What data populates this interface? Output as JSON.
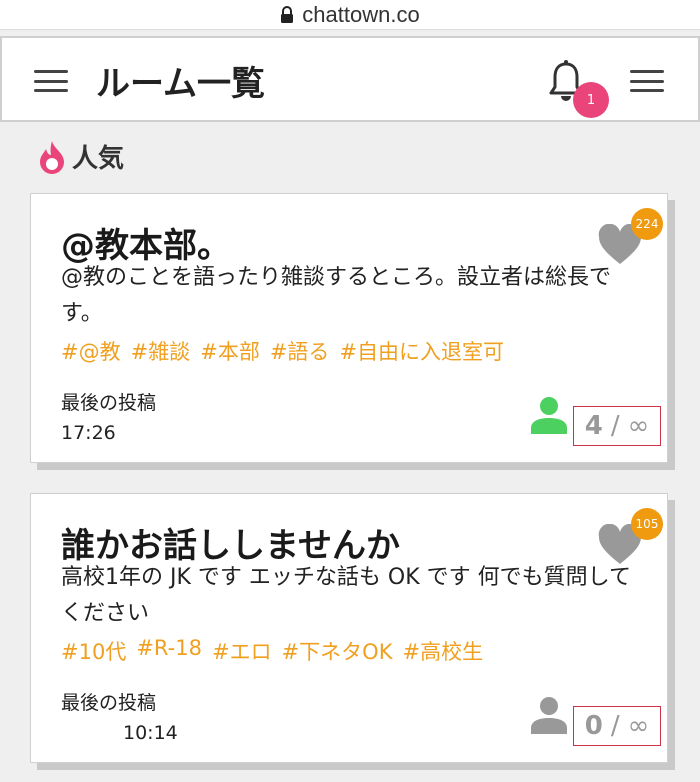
{
  "browser": {
    "url": "chattown.co"
  },
  "appbar": {
    "title": "ルーム一覧",
    "notification_count": "1"
  },
  "section": {
    "title": "人気"
  },
  "colors": {
    "accent": "#f0a020",
    "badge_pink": "#e9457a",
    "badge_orange": "#f09a10",
    "online_green": "#4cd060",
    "offline_gray": "#999999"
  },
  "rooms": [
    {
      "title": "@教本部。",
      "description": "@教のことを語ったり雑談するところ。設立者は総長です。",
      "tags": [
        "#@教",
        "#雑談",
        "#本部",
        "#語る",
        "#自由に入退室可"
      ],
      "likes": "224",
      "last_post_label": "最後の投稿",
      "last_post_time": "17:26",
      "members": "4",
      "separator": "/",
      "capacity": "∞",
      "online": true
    },
    {
      "title": "誰かお話ししませんか",
      "description": "高校1年の JK です エッチな話も OK です 何でも質問してください",
      "tags": [
        "#10代",
        "#R-18",
        "#エロ",
        "#下ネタOK",
        "#高校生"
      ],
      "likes": "105",
      "last_post_label": "最後の投稿",
      "last_post_time": "10:14",
      "members": "0",
      "separator": "/",
      "capacity": "∞",
      "online": false
    }
  ]
}
